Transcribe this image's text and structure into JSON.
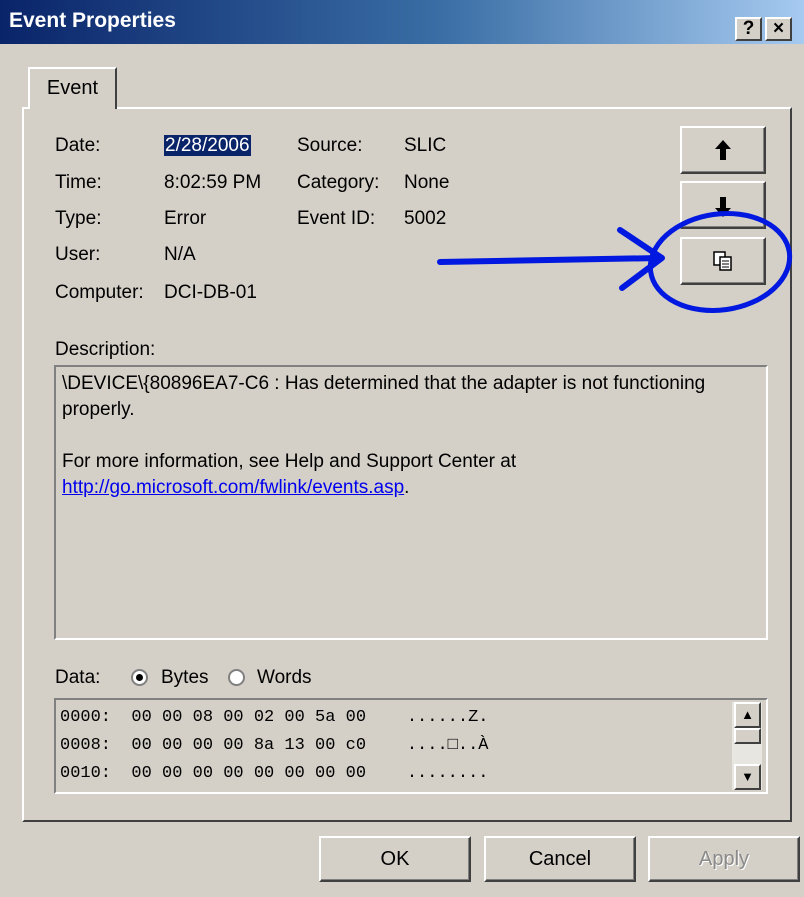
{
  "window": {
    "title": "Event Properties",
    "help_label": "?",
    "close_label": "×"
  },
  "tab": {
    "label": "Event"
  },
  "fields": {
    "date_label": "Date:",
    "date_value": "2/28/2006",
    "time_label": "Time:",
    "time_value": "8:02:59 PM",
    "type_label": "Type:",
    "type_value": "Error",
    "user_label": "User:",
    "user_value": "N/A",
    "computer_label": "Computer:",
    "computer_value": "DCI-DB-01",
    "source_label": "Source:",
    "source_value": "SLIC",
    "category_label": "Category:",
    "category_value": "None",
    "eventid_label": "Event ID:",
    "eventid_value": "5002"
  },
  "nav": {
    "up_icon": "arrow-up-icon",
    "down_icon": "arrow-down-icon",
    "copy_icon": "copy-icon"
  },
  "description": {
    "label": "Description:",
    "line1": "\\DEVICE\\{80896EA7-C6 : Has determined that the adapter is not functioning properly.",
    "line2": "For more information, see Help and Support Center at",
    "link": "http://go.microsoft.com/fwlink/events.asp",
    "link_suffix": "."
  },
  "data": {
    "label": "Data:",
    "bytes_label": "Bytes",
    "words_label": "Words",
    "selected": "Bytes",
    "rows": [
      "0000:  00 00 08 00 02 00 5a 00    ......Z.",
      "0008:  00 00 00 00 8a 13 00 c0    ....□..À",
      "0010:  00 00 00 00 00 00 00 00    ........"
    ]
  },
  "buttons": {
    "ok": "OK",
    "cancel": "Cancel",
    "apply": "Apply"
  },
  "colors": {
    "face": "#d4d0c8",
    "titlebar": "#0a246a",
    "annotation": "#0018e0",
    "link": "#0000ee"
  }
}
